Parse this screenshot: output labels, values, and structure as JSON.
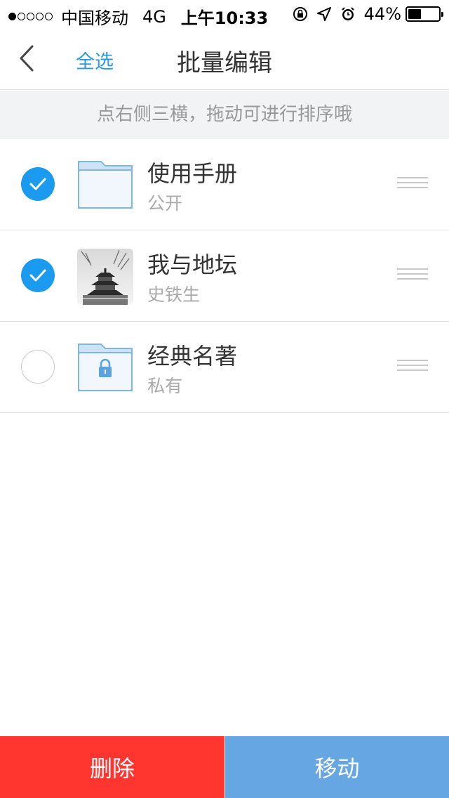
{
  "status_bar": {
    "carrier": "中国移动",
    "network": "4G",
    "time": "上午10:33",
    "battery": "44%",
    "battery_level": 0.44,
    "signal_filled": 1,
    "signal_total": 5,
    "icons": [
      "orientation-lock-icon",
      "location-arrow-icon",
      "alarm-icon",
      "battery-icon"
    ]
  },
  "nav": {
    "back_icon": "chevron-left-icon",
    "select_all": "全选",
    "title": "批量编辑"
  },
  "hint": "点右侧三横，拖动可进行排序哦",
  "items": [
    {
      "title": "使用手册",
      "subtitle": "公开",
      "checked": true,
      "thumb": "folder-icon"
    },
    {
      "title": "我与地坛",
      "subtitle": "史铁生",
      "checked": true,
      "thumb": "temple-photo"
    },
    {
      "title": "经典名著",
      "subtitle": "私有",
      "checked": false,
      "thumb": "locked-folder-icon"
    }
  ],
  "actions": {
    "delete": "删除",
    "move": "移动"
  },
  "colors": {
    "accent": "#1b9bf0",
    "link": "#2a9bdc",
    "delete_bg": "#ff3530",
    "move_bg": "#66a6e3"
  }
}
